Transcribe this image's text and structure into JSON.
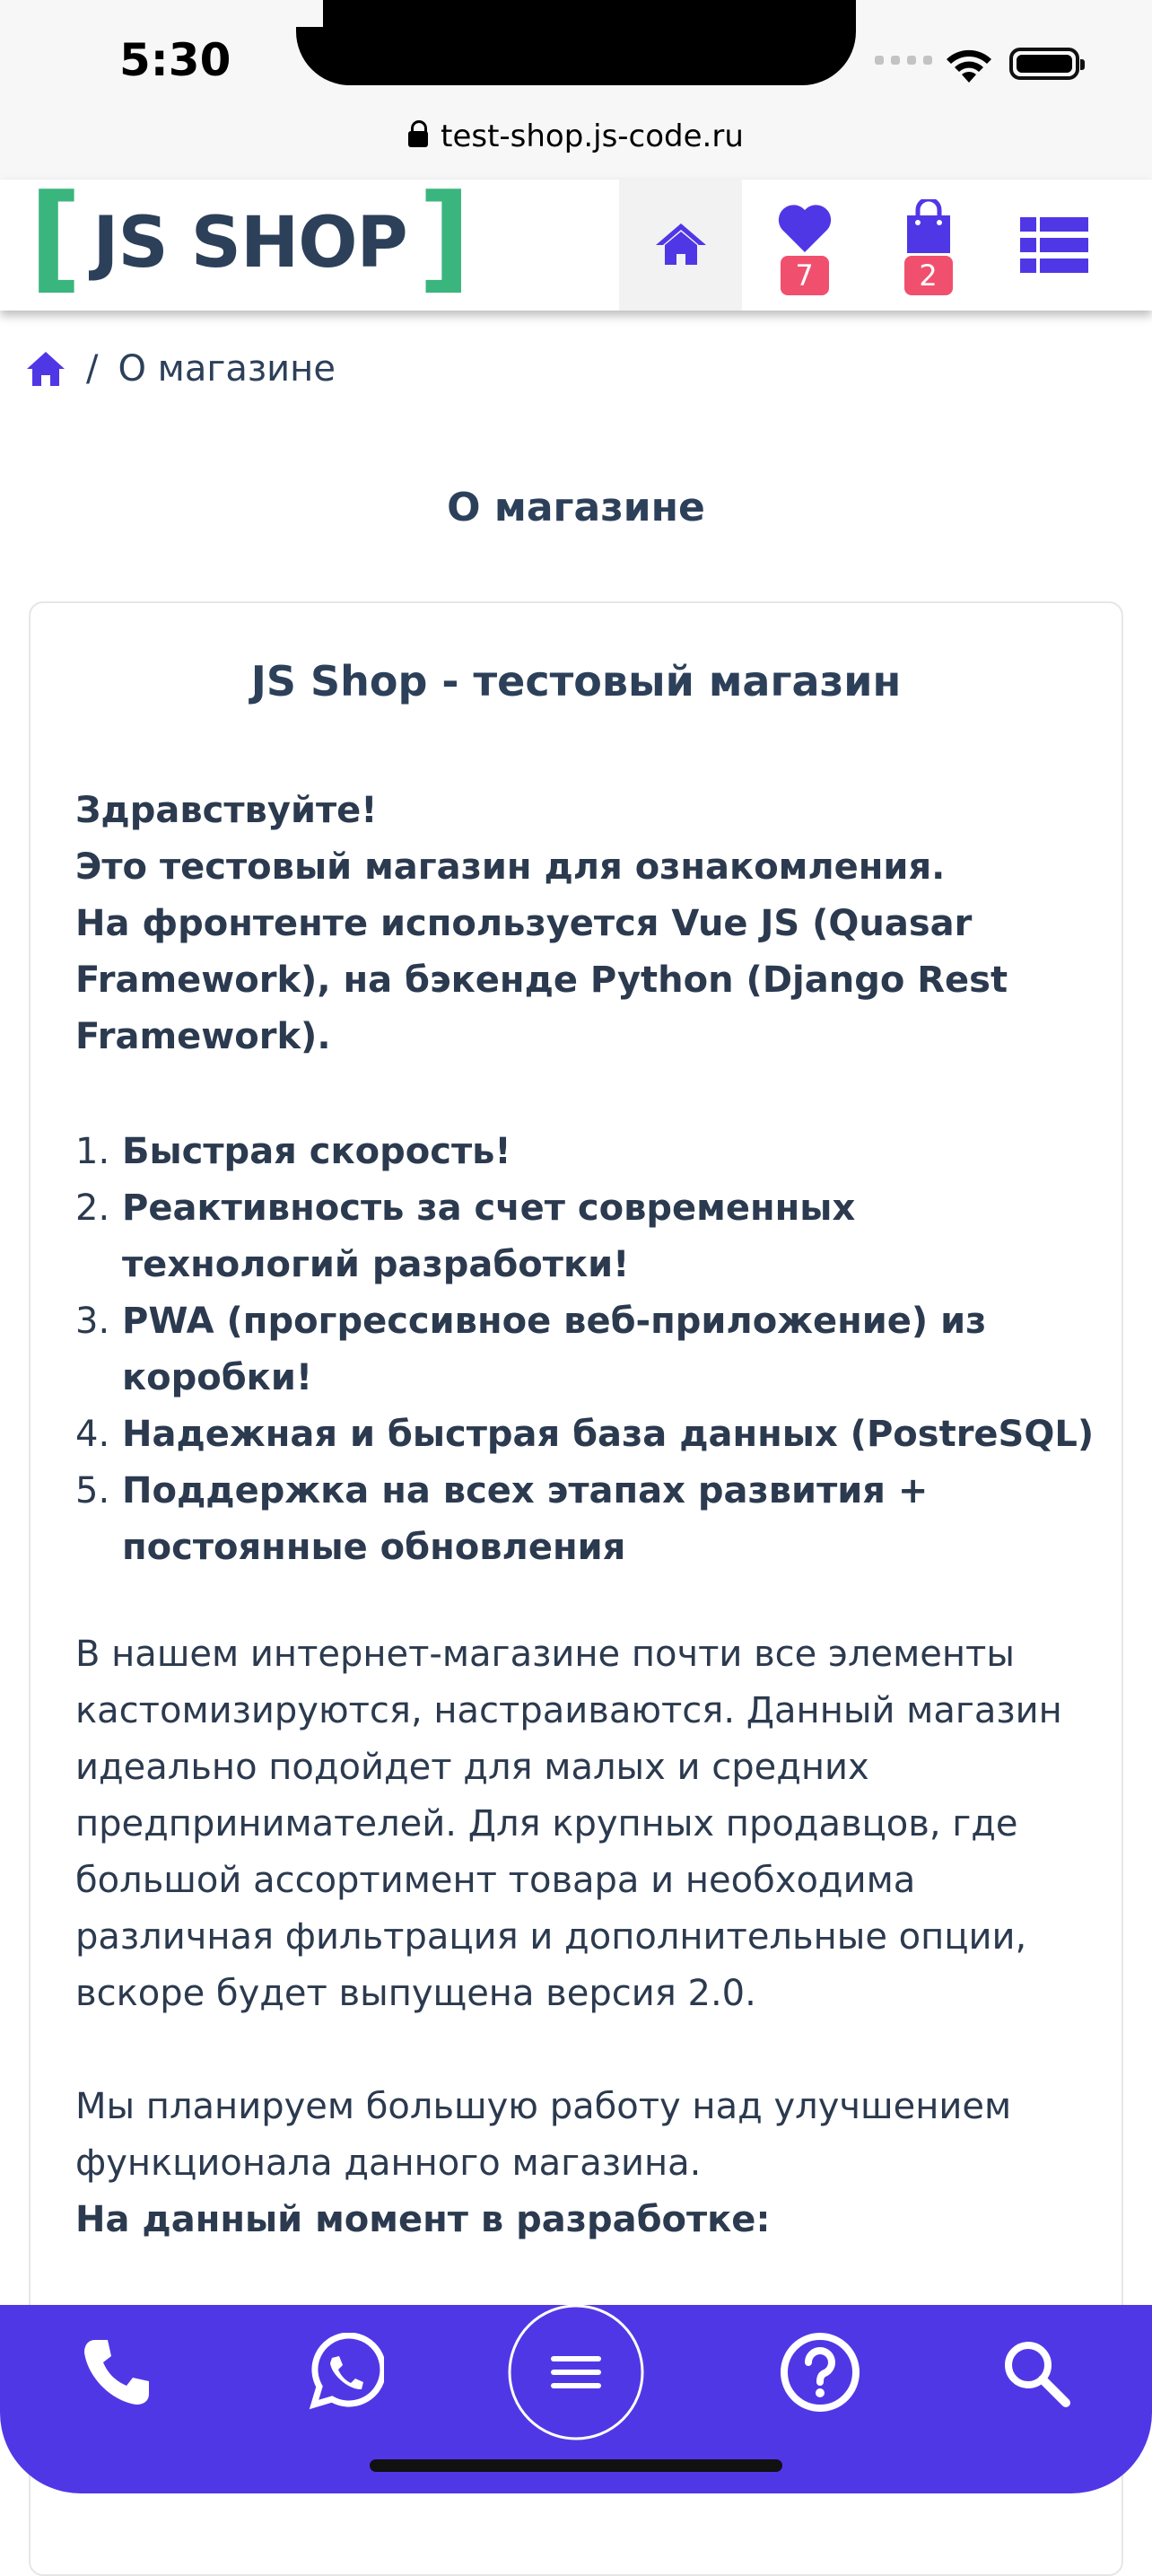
{
  "status_bar": {
    "time": "5:30"
  },
  "browser": {
    "url": "test-shop.js-code.ru"
  },
  "header": {
    "logo_left_bracket": "[",
    "logo_text": "JS SHOP",
    "logo_right_bracket": "]",
    "favorites_count": "7",
    "cart_count": "2"
  },
  "breadcrumb": {
    "separator": "/",
    "current": "О магазине"
  },
  "page": {
    "title": "О магазине",
    "card_title": "JS Shop - тестовый магазин",
    "intro_lines": [
      "Здравствуйте!",
      "Это тестовый магазин для ознакомления.",
      "На фронтенте используется Vue JS (Quasar Framework), на бэкенде Python (Django Rest Framework)."
    ],
    "features": [
      {
        "num": "1.",
        "text": "Быстрая скорость!"
      },
      {
        "num": "2.",
        "text": "Реактивность за счет современных технологий разработки!"
      },
      {
        "num": "3.",
        "text": "PWA (прогрессивное веб-приложение) из коробки!"
      },
      {
        "num": "4.",
        "text": "Надежная и быстрая база данных (PostreSQL)"
      },
      {
        "num": "5.",
        "text": "Поддержка на всех этапах развития + постоянные обновления"
      }
    ],
    "paragraph1": "В нашем интернет-магазине почти все элементы кастомизируются, настраиваются. Данный магазин идеально подойдет для малых и средних предпринимателей. Для крупных продавцов, где большой ассортимент товара и необходима различная фильтрация и дополнительные опции, вскоре будет выпущена версия 2.0.",
    "paragraph2": "Мы планируем большую работу над улучшением функционала данного магазина.",
    "dev_heading": "На данный момент в разработке:"
  },
  "colors": {
    "primary": "#5037e6",
    "logo_green": "#3ab57e",
    "text_dark": "#2d405a",
    "badge": "#f0506e"
  },
  "icons": {
    "header": [
      "home-icon",
      "heart-icon",
      "shopping-bag-icon",
      "list-icon"
    ],
    "bottom_nav": [
      "phone-icon",
      "whatsapp-icon",
      "menu-icon",
      "help-icon",
      "search-icon"
    ]
  }
}
